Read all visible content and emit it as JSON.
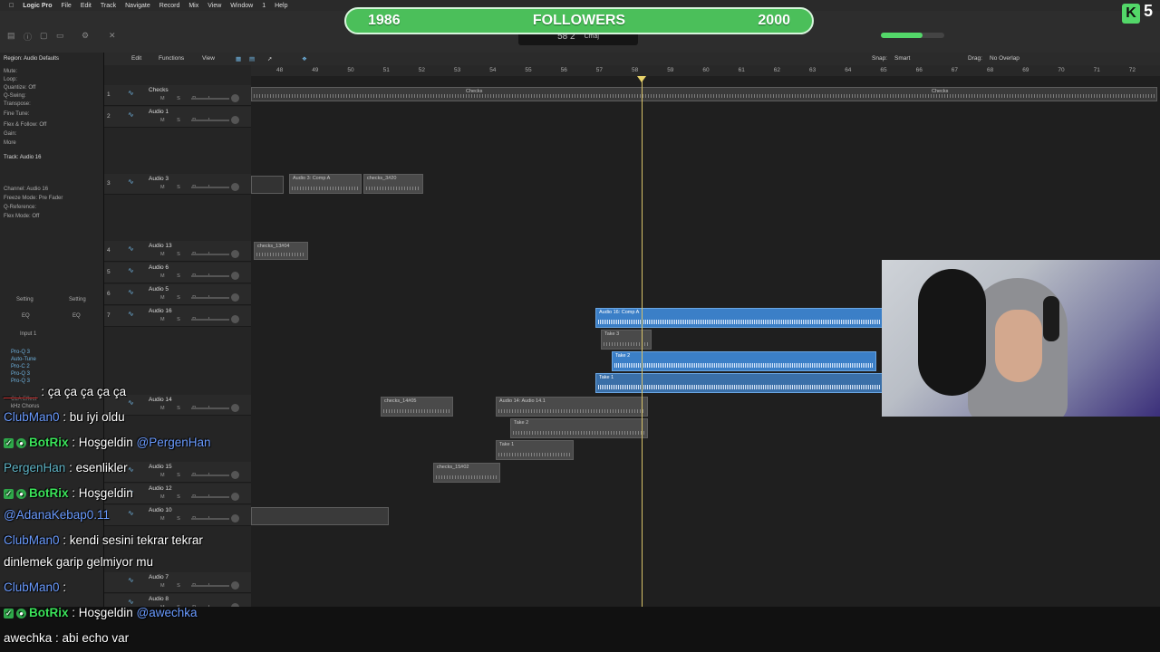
{
  "menubar": {
    "app": "Logic Pro",
    "items": [
      "File",
      "Edit",
      "Track",
      "Navigate",
      "Record",
      "Mix",
      "View",
      "Window",
      "1",
      "Help"
    ]
  },
  "banner": {
    "left_value": "1986",
    "title": "FOLLOWERS",
    "right_value": "2000",
    "goal_fraction": 0.993
  },
  "kick": {
    "badge": "K",
    "count": "5"
  },
  "lcd": {
    "bar_beat": "58 2",
    "key": "Cmaj"
  },
  "inspector": {
    "region_label": "Region: Audio Defaults",
    "track_label": "Track: Audio 16",
    "rows": [
      "Mute:",
      "Loop:",
      "Quantize: Off",
      "Q-Swing:",
      "Transpose:",
      "Fine Tune:",
      "Flex & Follow: Off",
      "Gain:",
      "More"
    ],
    "track_rows": [
      "Channel: Audio 16",
      "Freeze Mode: Pre Fader",
      "Q-Reference:",
      "Flex Mode: Off"
    ],
    "setting_labels": [
      "Setting",
      "Setting",
      "EQ",
      "EQ",
      "Input 1"
    ],
    "plugins": [
      "Pro-Q 3",
      "Auto-Tune",
      "Pro-C 2",
      "Pro-Q 3",
      "Pro-Q 3",
      "CLA Effect",
      "kHz Chorus"
    ]
  },
  "localbar": {
    "edit": "Edit",
    "functions": "Functions",
    "view": "View",
    "snap_label": "Snap:",
    "snap_value": "Smart",
    "drag_label": "Drag:",
    "drag_value": "No Overlap"
  },
  "ruler": [
    "48",
    "49",
    "50",
    "51",
    "52",
    "53",
    "54",
    "55",
    "56",
    "57",
    "58",
    "59",
    "60",
    "61",
    "62",
    "63",
    "64",
    "65",
    "66",
    "67",
    "68",
    "69",
    "70",
    "71",
    "72"
  ],
  "tracks": [
    {
      "num": "1",
      "name": "Checks"
    },
    {
      "num": "2",
      "name": "Audio 1"
    },
    {
      "num": "3",
      "name": "Audio 3"
    },
    {
      "num": "4",
      "name": "Audio 13"
    },
    {
      "num": "5",
      "name": "Audio 6"
    },
    {
      "num": "6",
      "name": "Audio 5"
    },
    {
      "num": "7",
      "name": "Audio 16"
    },
    {
      "num": "",
      "name": "Audio 14"
    },
    {
      "num": "",
      "name": "Audio 15"
    },
    {
      "num": "",
      "name": "Audio 12"
    },
    {
      "num": "",
      "name": "Audio 10"
    },
    {
      "num": "",
      "name": "Audio 7"
    },
    {
      "num": "",
      "name": "Audio 8"
    }
  ],
  "regions": {
    "checks_a": "Checks",
    "checks_b": "Checks",
    "comp3a": "Audio 3: Comp A",
    "comp3b": "checks_3#20",
    "r13": "checks_13#04",
    "comp16": "Audio 16: Comp A",
    "take3": "Take 3",
    "take2": "Take 2",
    "take1": "Take 1",
    "r14a": "checks_14#05",
    "r14b": "Audio 14: Audio 14.1",
    "take2b": "Take 2",
    "take1b": "Take 1",
    "r15": "checks_15#02"
  },
  "chat": [
    {
      "user": "_____",
      "text": " : ça ça ça ça ça",
      "color": "red"
    },
    {
      "user": "ClubMan0",
      "text": " : bu iyi oldu",
      "color": "blue"
    },
    {
      "user": "BotRix",
      "text": " : Hoşgeldin ",
      "mention": "@PergenHan",
      "color": "green",
      "badges": true
    },
    {
      "user": "PergenHan",
      "text": " : esenlikler",
      "color": "teal"
    },
    {
      "user": "BotRix",
      "text": " : Hoşgeldin",
      "color": "green",
      "badges": true
    },
    {
      "user": "@AdanaKebap0.11",
      "text": "",
      "color": "blue"
    },
    {
      "user": "ClubMan0",
      "text": " : kendi sesini tekrar tekrar",
      "color": "blue"
    },
    {
      "user": "",
      "text": "dinlemek garip gelmiyor mu",
      "color": "white"
    },
    {
      "user": "ClubMan0",
      "text": " : ",
      "color": "blue"
    },
    {
      "user": "BotRix",
      "text": " : Hoşgeldin ",
      "mention": "@awechka",
      "color": "green",
      "badges": true
    },
    {
      "user": "awechka",
      "text": " : abi echo var",
      "color": "white"
    }
  ],
  "colors": {
    "banner": "#4bbf5a",
    "region_blue": "#3b7fc7",
    "playhead": "#d9c36a"
  }
}
